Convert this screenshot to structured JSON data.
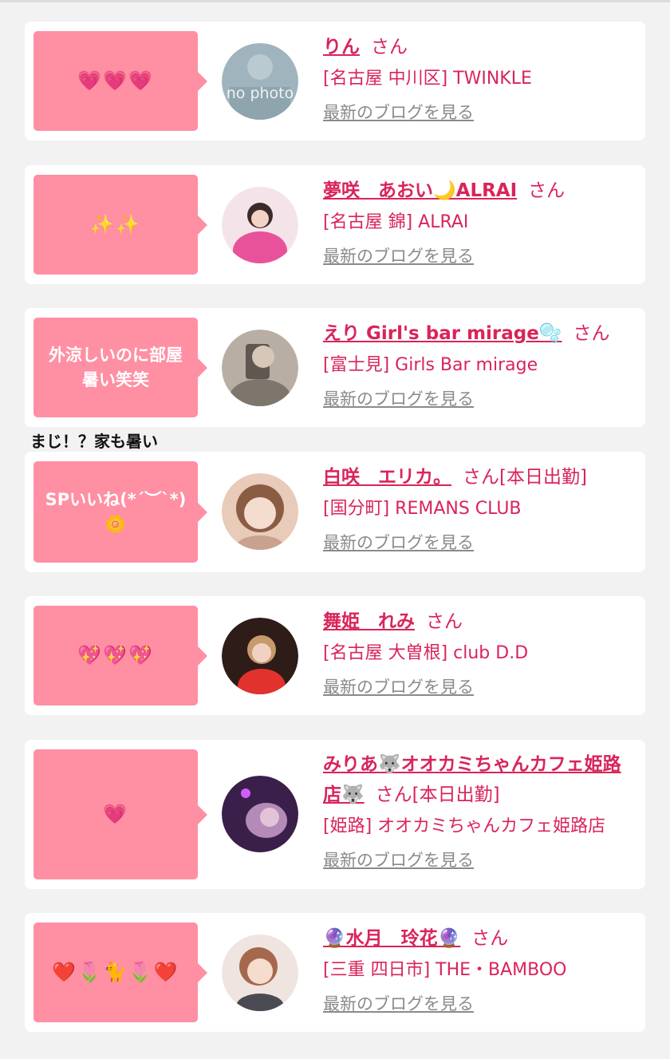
{
  "items": [
    {
      "bubble": "💗💗💗",
      "name": "りん",
      "san": "さん",
      "status": "",
      "store": "[名古屋 中川区] TWINKLE",
      "blog": "最新のブログを見る",
      "avatar_text": "no photo",
      "avatar_bg": "#9fb4bd"
    },
    {
      "bubble": "✨✨",
      "name": "夢咲　あおい🌙ALRAI",
      "san": "さん",
      "status": "",
      "store": "[名古屋 錦] ALRAI",
      "blog": "最新のブログを見る",
      "avatar_text": "",
      "avatar_bg": "#e87aa8"
    },
    {
      "bubble": "外涼しいのに部屋暑い笑笑",
      "name": "えり Girl's bar mirage🫧",
      "san": "さん",
      "status": "",
      "store": "[富士見] Girls Bar mirage",
      "blog": "最新のブログを見る",
      "avatar_text": "",
      "avatar_bg": "#8b7d70"
    },
    {
      "bubble": "SPいいね(*´︶`*)🌼",
      "name": "白咲　エリカ。",
      "san": "さん",
      "status": "[本日出勤]",
      "store": "[国分町] REMANS CLUB",
      "blog": "最新のブログを見る",
      "avatar_text": "",
      "avatar_bg": "#c9a08a"
    },
    {
      "bubble": "💖💖💖",
      "name": "舞姫　れみ",
      "san": "さん",
      "status": "",
      "store": "[名古屋 大曽根] club D.D",
      "blog": "最新のブログを見る",
      "avatar_text": "",
      "avatar_bg": "#5a2a22"
    },
    {
      "bubble": "💗",
      "name": "みりあ🐺オオカミちゃんカフェ姫路店🐺",
      "san": "さん",
      "status": "[本日出勤]",
      "store": "[姫路] オオカミちゃんカフェ姫路店",
      "blog": "最新のブログを見る",
      "avatar_text": "",
      "avatar_bg": "#4b2a5e"
    },
    {
      "bubble": "❤️🌷🐈🌷❤️",
      "name": "🔮水月　玲花🔮",
      "san": "さん",
      "status": "",
      "store": "[三重 四日市] THE・BAMBOO",
      "blog": "最新のブログを見る",
      "avatar_text": "",
      "avatar_bg": "#d9c3b8"
    }
  ],
  "reply_text": "まじ！？家も暑い"
}
